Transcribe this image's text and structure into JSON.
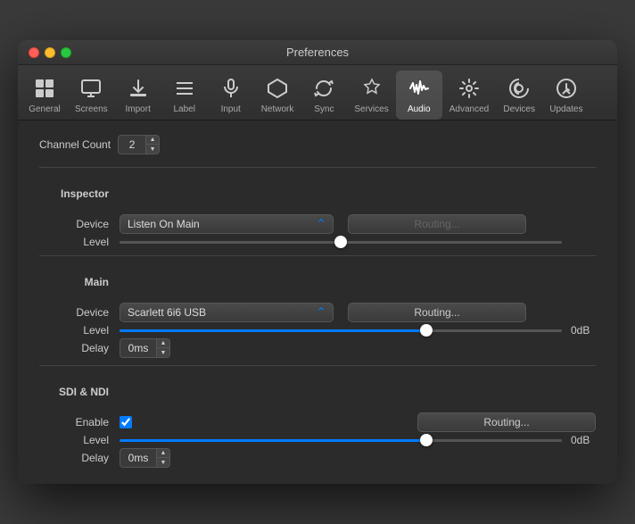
{
  "window": {
    "title": "Preferences"
  },
  "toolbar": {
    "items": [
      {
        "id": "general",
        "label": "General",
        "icon": "⊞"
      },
      {
        "id": "screens",
        "label": "Screens",
        "icon": "🖥"
      },
      {
        "id": "import",
        "label": "Import",
        "icon": "⬇"
      },
      {
        "id": "label",
        "label": "Label",
        "icon": "≡"
      },
      {
        "id": "input",
        "label": "Input",
        "icon": "🎙"
      },
      {
        "id": "network",
        "label": "Network",
        "icon": "⬡"
      },
      {
        "id": "sync",
        "label": "Sync",
        "icon": "↺"
      },
      {
        "id": "services",
        "label": "Services",
        "icon": "🔑"
      },
      {
        "id": "audio",
        "label": "Audio",
        "icon": "〜"
      },
      {
        "id": "advanced",
        "label": "Advanced",
        "icon": "⚙"
      },
      {
        "id": "devices",
        "label": "Devices",
        "icon": "📡"
      },
      {
        "id": "updates",
        "label": "Updates",
        "icon": "⬇"
      }
    ],
    "active": "audio"
  },
  "content": {
    "channel_count_label": "Channel Count",
    "channel_count_value": "2",
    "inspector_section": "Inspector",
    "inspector_device_label": "Device",
    "inspector_device_value": "Listen On Main",
    "inspector_level_label": "Level",
    "inspector_routing_label": "Routing...",
    "inspector_routing_disabled": true,
    "main_section": "Main",
    "main_device_label": "Device",
    "main_device_value": "Scarlett 6i6 USB",
    "main_level_label": "Level",
    "main_level_value": "0dB",
    "main_routing_label": "Routing...",
    "main_delay_label": "Delay",
    "main_delay_value": "0ms",
    "sdi_section": "SDI & NDI",
    "sdi_enable_label": "Enable",
    "sdi_level_label": "Level",
    "sdi_level_value": "0dB",
    "sdi_routing_label": "Routing...",
    "sdi_delay_label": "Delay",
    "sdi_delay_value": "0ms"
  }
}
